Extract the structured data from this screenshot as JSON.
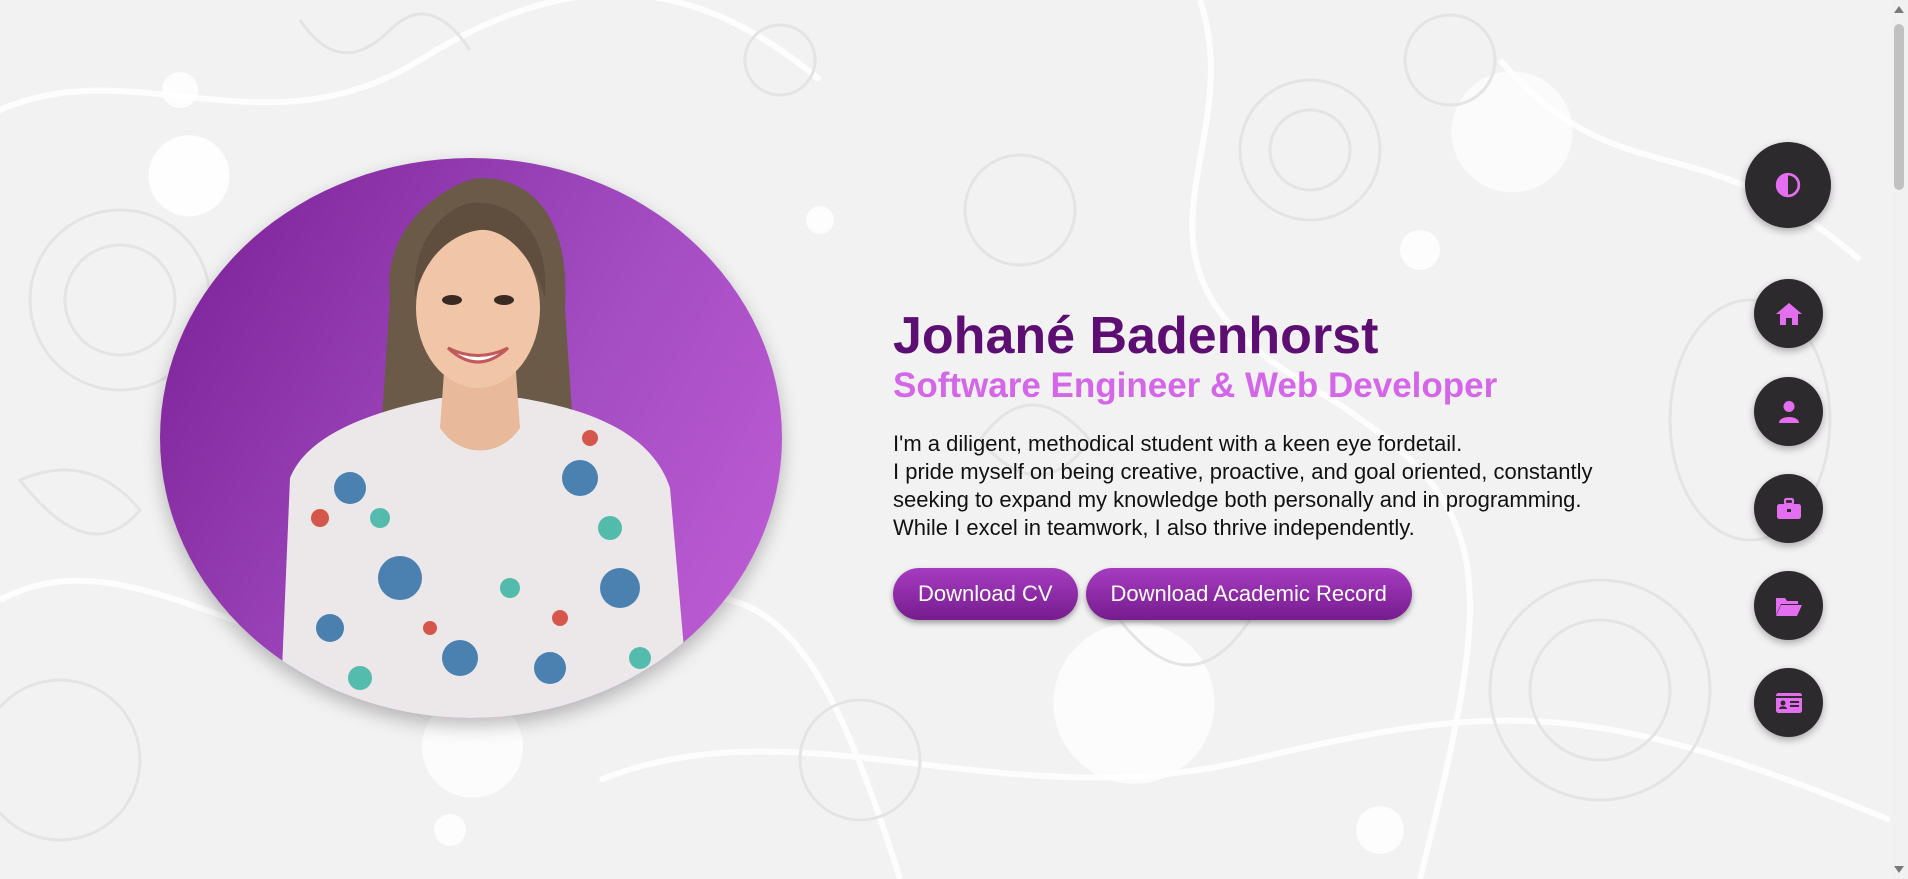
{
  "profile": {
    "name": "Johané Badenhorst",
    "role": "Software Engineer & Web Developer",
    "bio_lines": [
      "I'm a diligent, methodical student with a keen eye fordetail.",
      "I pride myself on being creative, proactive, and goal oriented, constantly",
      "seeking to expand my knowledge both personally and in programming.",
      "While I excel in teamwork, I also thrive independently."
    ]
  },
  "actions": {
    "download_cv": "Download CV",
    "download_academic": "Download Academic Record"
  },
  "nav": {
    "theme_icon": "contrast-icon",
    "items": [
      {
        "icon": "home-icon"
      },
      {
        "icon": "user-icon"
      },
      {
        "icon": "briefcase-icon"
      },
      {
        "icon": "folder-open-icon"
      },
      {
        "icon": "id-card-icon"
      }
    ]
  },
  "colors": {
    "name": "#5d0e73",
    "role": "#d467e8",
    "button": "#8e2aa8",
    "icon": "#e36ff0",
    "nav_bg": "#2c2a2c"
  }
}
